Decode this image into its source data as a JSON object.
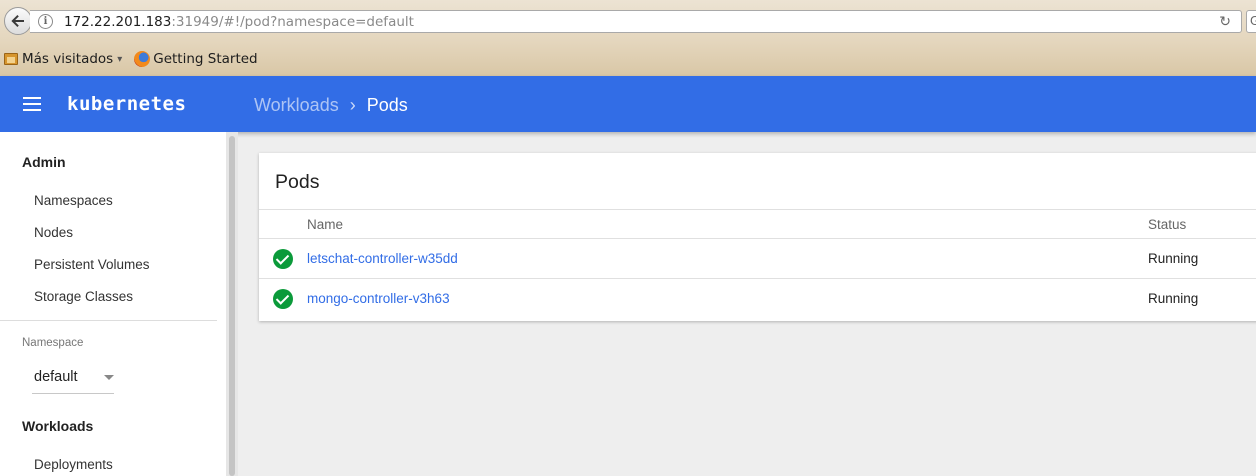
{
  "browser": {
    "url_host": "172.22.201.183",
    "url_rest": ":31949/#!/pod?namespace=default",
    "bookmarks": [
      {
        "label": "Más visitados"
      },
      {
        "label": "Getting Started"
      }
    ]
  },
  "appbar": {
    "brand": "kubernetes",
    "breadcrumb_parent": "Workloads",
    "breadcrumb_current": "Pods"
  },
  "sidebar": {
    "admin_header": "Admin",
    "admin_items": [
      {
        "label": "Namespaces"
      },
      {
        "label": "Nodes"
      },
      {
        "label": "Persistent Volumes"
      },
      {
        "label": "Storage Classes"
      }
    ],
    "namespace_label": "Namespace",
    "namespace_value": "default",
    "workloads_header": "Workloads",
    "workloads_items": [
      {
        "label": "Deployments"
      }
    ]
  },
  "pods_card": {
    "title": "Pods",
    "columns": {
      "name": "Name",
      "status": "Status"
    },
    "rows": [
      {
        "name": "letschat-controller-w35dd",
        "status": "Running"
      },
      {
        "name": "mongo-controller-v3h63",
        "status": "Running"
      }
    ],
    "status_color": "#0b9a3a"
  },
  "theme": {
    "brand_blue": "#326de6"
  }
}
